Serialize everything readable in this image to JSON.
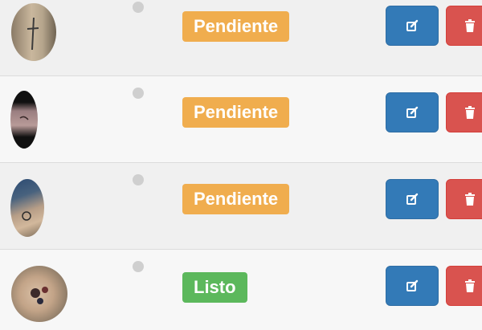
{
  "rows": [
    {
      "photo_icon": "tattoo-photo-arm",
      "status_label": "Pendiente",
      "status_color": "#f0ad4e",
      "edit_icon": "edit-icon",
      "delete_icon": "trash-icon"
    },
    {
      "photo_icon": "tattoo-photo-wrist",
      "status_label": "Pendiente",
      "status_color": "#f0ad4e",
      "edit_icon": "edit-icon",
      "delete_icon": "trash-icon"
    },
    {
      "photo_icon": "tattoo-photo-forearm",
      "status_label": "Pendiente",
      "status_color": "#f0ad4e",
      "edit_icon": "edit-icon",
      "delete_icon": "trash-icon"
    },
    {
      "photo_icon": "tattoo-photo-leg",
      "status_label": "Listo",
      "status_color": "#5cb85c",
      "edit_icon": "edit-icon",
      "delete_icon": "trash-icon"
    }
  ]
}
